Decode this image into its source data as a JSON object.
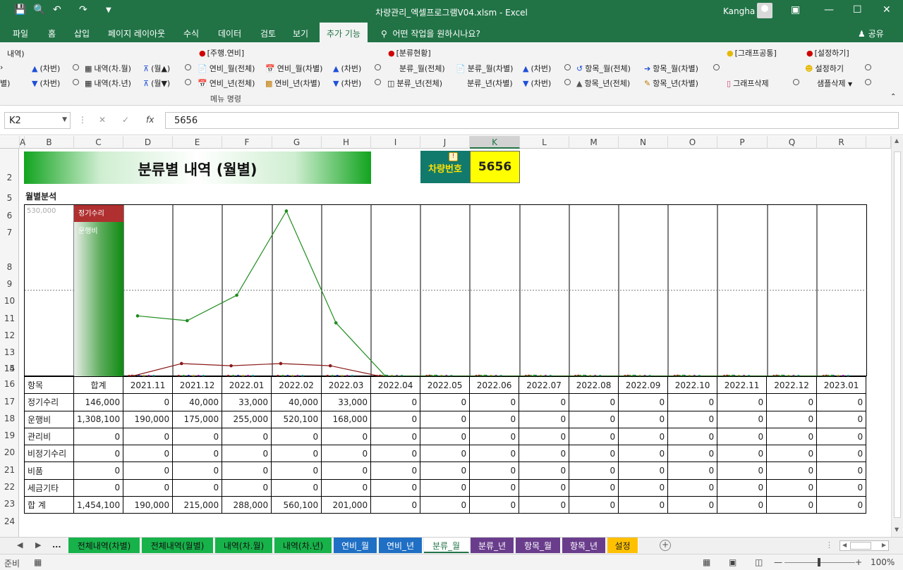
{
  "titlebar": {
    "title": "차량관리_엑셀프로그램V04.xlsm  -  Excel",
    "user": "Kangha"
  },
  "tabs": [
    "파일",
    "홈",
    "삽입",
    "페이지 레이아웃",
    "수식",
    "데이터",
    "검토",
    "보기",
    "추가 기능"
  ],
  "active_tab": "추가 기능",
  "tell_me": "어떤 작업을 원하시나요?",
  "share": "공유",
  "ribbon": {
    "group_labels": [
      "[주행.연비]",
      "[분류현황]",
      "[그래프공통]",
      "[설정하기]"
    ],
    "caption": "메뉴 명령",
    "row1": [
      "내역)",
      "(차번)",
      "내역(차.월)",
      "(월▲)",
      "연비_월(전체)",
      "연비_월(차별)",
      "(차번)",
      "분류_월(전체)",
      "분류_월(차별)",
      "(차번)",
      "항목_월(전체)",
      "항목_월(차별)",
      "설정하기"
    ],
    "row2": [
      "별)",
      "(차번)",
      "내역(차.년)",
      "(월▼)",
      "연비_년(전체)",
      "연비_년(차별)",
      "(차번)",
      "분류_년(전체)",
      "분류_년(차별)",
      "(차번)",
      "항목_년(전체)",
      "항목_년(차별)",
      "그래프삭제",
      "샘플삭제"
    ]
  },
  "formula_bar": {
    "name_box": "K2",
    "formula": "5656"
  },
  "columns": [
    "A",
    "B",
    "C",
    "D",
    "E",
    "F",
    "G",
    "H",
    "I",
    "J",
    "K",
    "L",
    "M",
    "N",
    "O",
    "P",
    "Q",
    "R"
  ],
  "selected_column": "K",
  "rows": [
    "1",
    "2",
    "5",
    "6",
    "7",
    "8",
    "9",
    "10",
    "11",
    "12",
    "13",
    "14",
    "15",
    "16",
    "17",
    "18",
    "19",
    "20",
    "21",
    "22",
    "23",
    "24"
  ],
  "sheet": {
    "banner": "분류별 내역 (월별)",
    "car_label": "차량번호",
    "car_number": "5656",
    "subtitle": "월별분석",
    "table_header": [
      "항목",
      "합계",
      "2021.11",
      "2021.12",
      "2022.01",
      "2022.02",
      "2022.03",
      "2022.04",
      "2022.05",
      "2022.06",
      "2022.07",
      "2022.08",
      "2022.09",
      "2022.10",
      "2022.11",
      "2022.12",
      "2023.01"
    ],
    "table_rows": [
      {
        "label": "정기수리",
        "values": [
          "146,000",
          "0",
          "40,000",
          "33,000",
          "40,000",
          "33,000",
          "0",
          "0",
          "0",
          "0",
          "0",
          "0",
          "0",
          "0",
          "0",
          "0"
        ]
      },
      {
        "label": "운행비",
        "values": [
          "1,308,100",
          "190,000",
          "175,000",
          "255,000",
          "520,100",
          "168,000",
          "0",
          "0",
          "0",
          "0",
          "0",
          "0",
          "0",
          "0",
          "0",
          "0"
        ]
      },
      {
        "label": "관리비",
        "values": [
          "0",
          "0",
          "0",
          "0",
          "0",
          "0",
          "0",
          "0",
          "0",
          "0",
          "0",
          "0",
          "0",
          "0",
          "0",
          "0"
        ]
      },
      {
        "label": "비정기수리",
        "values": [
          "0",
          "0",
          "0",
          "0",
          "0",
          "0",
          "0",
          "0",
          "0",
          "0",
          "0",
          "0",
          "0",
          "0",
          "0",
          "0"
        ]
      },
      {
        "label": "비품",
        "values": [
          "0",
          "0",
          "0",
          "0",
          "0",
          "0",
          "0",
          "0",
          "0",
          "0",
          "0",
          "0",
          "0",
          "0",
          "0",
          "0"
        ]
      },
      {
        "label": "세금기타",
        "values": [
          "0",
          "0",
          "0",
          "0",
          "0",
          "0",
          "0",
          "0",
          "0",
          "0",
          "0",
          "0",
          "0",
          "0",
          "0",
          "0"
        ]
      },
      {
        "label": "합 계",
        "values": [
          "1,454,100",
          "190,000",
          "215,000",
          "288,000",
          "560,100",
          "201,000",
          "0",
          "0",
          "0",
          "0",
          "0",
          "0",
          "0",
          "0",
          "0",
          "0"
        ]
      }
    ]
  },
  "chart_data": {
    "type": "line",
    "ymax_label": "530,000",
    "legend": [
      "정기수리",
      "운행비"
    ],
    "categories": [
      "2021.11",
      "2021.12",
      "2022.01",
      "2022.02",
      "2022.03",
      "2022.04",
      "2022.05",
      "2022.06",
      "2022.07",
      "2022.08",
      "2022.09",
      "2022.10",
      "2022.11",
      "2022.12",
      "2023.01"
    ],
    "ylim": [
      0,
      530000
    ],
    "series": [
      {
        "name": "정기수리",
        "color": "#8b1a1a",
        "values": [
          0,
          40000,
          33000,
          40000,
          33000,
          0,
          0,
          0,
          0,
          0,
          0,
          0,
          0,
          0,
          0
        ]
      },
      {
        "name": "운행비",
        "color": "#1e8c1e",
        "values": [
          190000,
          175000,
          255000,
          520100,
          168000,
          0,
          0,
          0,
          0,
          0,
          0,
          0,
          0,
          0,
          0
        ]
      }
    ],
    "zero_marker_colors": [
      "#8b1a1a",
      "#1e8c1e",
      "#1a2a8b",
      "#a09020",
      "#8b1a8b",
      "#1a8b8b"
    ]
  },
  "sheet_tabs": [
    {
      "label": "전체내역(차별)",
      "color": "#17b24a"
    },
    {
      "label": "전체내역(월별)",
      "color": "#17b24a"
    },
    {
      "label": "내역(차.월)",
      "color": "#17b24a"
    },
    {
      "label": "내역(차.년)",
      "color": "#17b24a"
    },
    {
      "label": "연비_월",
      "color": "#1f6fc4"
    },
    {
      "label": "연비_년",
      "color": "#1f6fc4"
    },
    {
      "label": "분류_월",
      "color": "#ffffff"
    },
    {
      "label": "분류_년",
      "color": "#6a3d8c"
    },
    {
      "label": "항목_월",
      "color": "#6a3d8c"
    },
    {
      "label": "항목_년",
      "color": "#6a3d8c"
    },
    {
      "label": "설정",
      "color": "#ffc000"
    }
  ],
  "sheet_tabs_ellipsis": "...",
  "status": {
    "ready": "준비",
    "zoom": "100%"
  }
}
